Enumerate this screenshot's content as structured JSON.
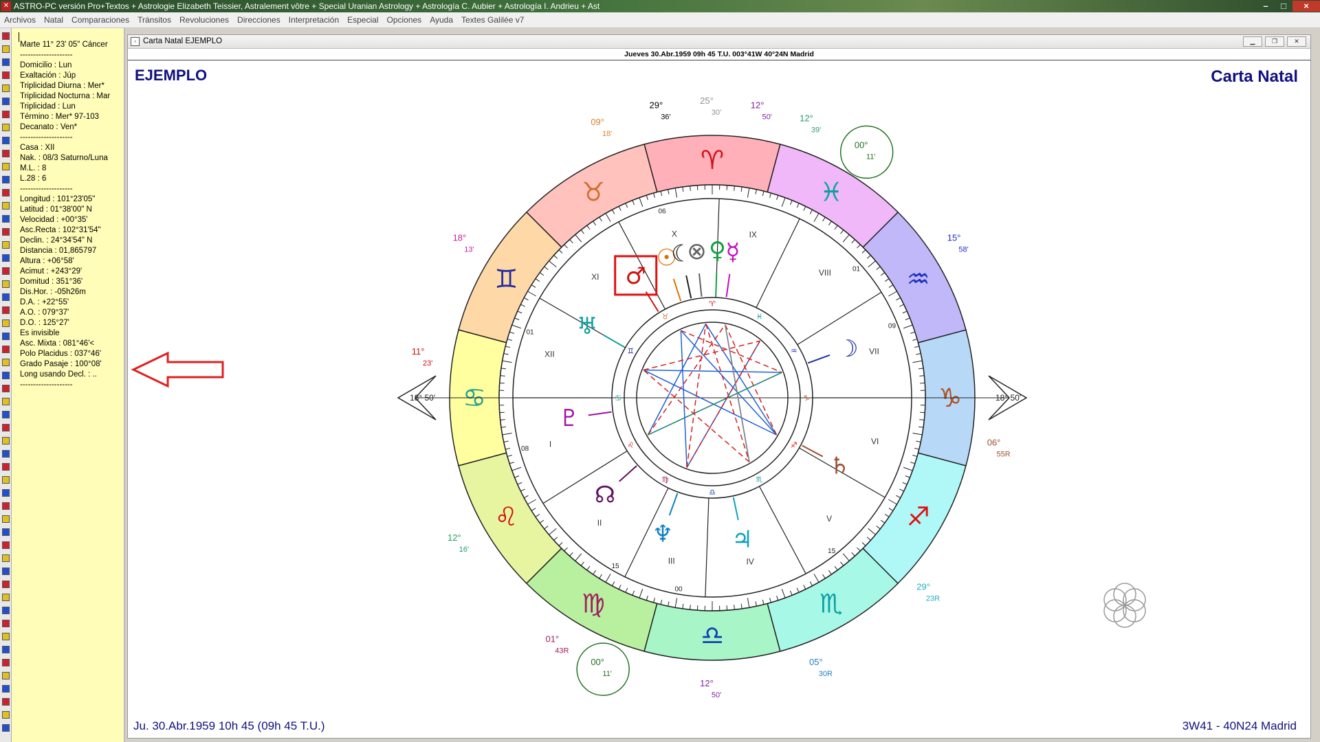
{
  "window": {
    "title": "ASTRO-PC versión Pro+Textos + Astrologie Elizabeth Teissier, Astralement vôtre + Special Uranian Astrology + Astrología C. Aubier + Astrología I. Andrieu + Ast"
  },
  "menu": [
    {
      "label": "Archivos"
    },
    {
      "label": "Natal"
    },
    {
      "label": "Comparaciones"
    },
    {
      "label": "Tránsitos"
    },
    {
      "label": "Revoluciones"
    },
    {
      "label": "Direcciones"
    },
    {
      "label": "Interpretación"
    },
    {
      "label": "Especial"
    },
    {
      "label": "Opciones"
    },
    {
      "label": "Ayuda"
    },
    {
      "label": "Textes Galilée v7"
    }
  ],
  "info_panel": {
    "lines": [
      "Marte 11° 23' 05\" Cáncer",
      "--------------------",
      "Domicilio : Lun",
      "Exaltación : Júp",
      "Triplicidad Diurna : Mer*",
      "Triplicidad Nocturna : Mar",
      "Triplicidad : Lun",
      "Término : Mer* 97-103",
      "Decanato : Ven*",
      "--------------------",
      "Casa : XII",
      "Nak. : 08/3  Saturno/Luna",
      "M.L. : 8",
      "L.28 : 6",
      "--------------------",
      "Longitud : 101°23'05\"",
      "Latitud : 01°38'00\" N",
      "Velocidad : +00°35'",
      "Asc.Recta : 102°31'54\"",
      "Declin. : 24°34'54\" N",
      "Distancia : 01,865797",
      "Altura : +06°58'",
      "Acimut : +243°29'",
      "Domitud : 351°36'",
      "Dis.Hor. : -05h26m",
      "D.A. : +22°55'",
      "A.O. : 079°37'",
      "D.O. : 125°27'",
      "Es invisible",
      "Asc. Mixta : 081°46'<",
      "Polo Placidus : 037°46'",
      "Grado Pasaje : 100°08'",
      "Long usando Decl. : ..",
      "--------------------"
    ]
  },
  "chart_window": {
    "doc_title": "Carta Natal  EJEMPLO",
    "header": "Jueves 30.Abr.1959 09h 45 T.U. 003°41W 40°24N  Madrid",
    "name": "EJEMPLO",
    "chart_title": "Carta Natal",
    "footer_left": "Ju. 30.Abr.1959 10h 45 (09h 45 T.U.)",
    "footer_right": "3W41 - 40N24  Madrid"
  },
  "wheel": {
    "asc_label": "18° 50'",
    "dsc_label": "18° 50'",
    "signs": [
      {
        "name": "aries",
        "glyph": "♈",
        "color": "#ffb0b8",
        "glyph_color": "#d0101a"
      },
      {
        "name": "taurus",
        "glyph": "♉",
        "color": "#ffc2bd",
        "glyph_color": "#d07030"
      },
      {
        "name": "gemini",
        "glyph": "♊",
        "color": "#ffd8a8",
        "glyph_color": "#2030a0"
      },
      {
        "name": "cancer",
        "glyph": "♋",
        "color": "#ffffa0",
        "glyph_color": "#20a090"
      },
      {
        "name": "leo",
        "glyph": "♌",
        "color": "#e8f5a0",
        "glyph_color": "#d01010"
      },
      {
        "name": "virgo",
        "glyph": "♍",
        "color": "#b8f0a0",
        "glyph_color": "#a02060"
      },
      {
        "name": "libra",
        "glyph": "♎",
        "color": "#a8f5c8",
        "glyph_color": "#1040b0"
      },
      {
        "name": "scorpio",
        "glyph": "♏",
        "color": "#a8f8e8",
        "glyph_color": "#10a0a0"
      },
      {
        "name": "sagittarius",
        "glyph": "♐",
        "color": "#b0f8f8",
        "glyph_color": "#e01010"
      },
      {
        "name": "capricorn",
        "glyph": "♑",
        "color": "#b8d8f8",
        "glyph_color": "#b05020"
      },
      {
        "name": "aquarius",
        "glyph": "♒",
        "color": "#c0b8f8",
        "glyph_color": "#2030c0"
      },
      {
        "name": "pisces",
        "glyph": "♓",
        "color": "#f0b8f8",
        "glyph_color": "#10a0a0"
      }
    ],
    "house_numbers": [
      "I",
      "II",
      "III",
      "IV",
      "V",
      "VI",
      "VII",
      "VIII",
      "IX",
      "X",
      "XI",
      "XII"
    ],
    "cusp_labels": [
      {
        "deg": "09°",
        "min": "18'",
        "color": "#e08030"
      },
      {
        "deg": "29°",
        "min": "36'",
        "color": "#000000"
      },
      {
        "deg": "25°",
        "min": "30'",
        "color": "#909090"
      },
      {
        "deg": "12°",
        "min": "50'",
        "color": "#8020a0"
      },
      {
        "deg": "12°",
        "min": "39'",
        "color": "#20a060"
      },
      {
        "deg": "00°",
        "min": "11'",
        "color": "#207020"
      },
      {
        "deg": "15°",
        "min": "58'",
        "color": "#2030c0"
      },
      {
        "deg": "06°",
        "min": "55R",
        "color": "#a05030"
      },
      {
        "deg": "29°",
        "min": "23R",
        "color": "#20b0c0"
      },
      {
        "deg": "05°",
        "min": "30R",
        "color": "#2080c0"
      },
      {
        "deg": "12°",
        "min": "50'",
        "color": "#8020a0"
      },
      {
        "deg": "00°",
        "min": "11'",
        "color": "#207020"
      },
      {
        "deg": "01°",
        "min": "43R",
        "color": "#a02060"
      },
      {
        "deg": "12°",
        "min": "16'",
        "color": "#20a060"
      },
      {
        "deg": "11°",
        "min": "23'",
        "color": "#d01010"
      },
      {
        "deg": "18°",
        "min": "13'",
        "color": "#c020a0"
      }
    ],
    "planets": [
      {
        "name": "sun",
        "glyph": "☉",
        "color": "#e07000"
      },
      {
        "name": "moon-node",
        "glyph": "☾",
        "color": "#202020"
      },
      {
        "name": "part-fortune",
        "glyph": "⊗",
        "color": "#606060"
      },
      {
        "name": "venus-sym",
        "glyph": "♀",
        "color": "#10a040"
      },
      {
        "name": "mercury",
        "glyph": "☿",
        "color": "#c010c0"
      },
      {
        "name": "mars",
        "glyph": "♂",
        "color": "#d01010"
      },
      {
        "name": "uranus",
        "glyph": "♅",
        "color": "#10a0a0"
      },
      {
        "name": "pluto",
        "glyph": "♇",
        "color": "#a010a0"
      },
      {
        "name": "north-node",
        "glyph": "☊",
        "color": "#601060"
      },
      {
        "name": "neptune",
        "glyph": "♆",
        "color": "#1080c0"
      },
      {
        "name": "jupiter",
        "glyph": "♃",
        "color": "#10a0c0"
      },
      {
        "name": "saturn",
        "glyph": "♄",
        "color": "#a05030"
      },
      {
        "name": "moon",
        "glyph": "☽",
        "color": "#2030a0"
      }
    ],
    "degree_ticks": [
      "06",
      "01",
      "09",
      "15",
      "00",
      "01",
      "08",
      "15"
    ]
  }
}
